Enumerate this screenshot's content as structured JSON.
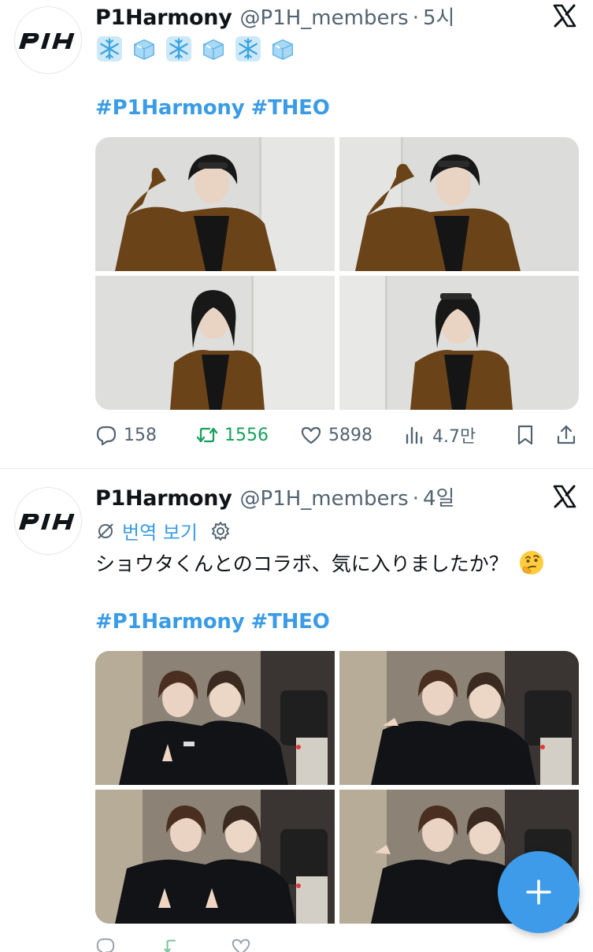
{
  "tweets": [
    {
      "display_name": "P1Harmony",
      "handle": "@P1H_members",
      "separator": "·",
      "time": "5시",
      "emojis": [
        "snowflake-icon",
        "ice-cube-icon",
        "snowflake-icon",
        "ice-cube-icon",
        "snowflake-icon",
        "ice-cube-icon"
      ],
      "hashtags": [
        "#P1Harmony",
        "#THEO"
      ],
      "photos": 4,
      "stats": {
        "replies": "158",
        "retweets": "1556",
        "likes": "5898",
        "views": "4.7만"
      }
    },
    {
      "display_name": "P1Harmony",
      "handle": "@P1H_members",
      "separator": "·",
      "time": "4일",
      "translate_label": "번역 보기",
      "text": "ショウタくんとのコラボ、気に入りましたか？",
      "text_emoji": "thinking-face-icon",
      "hashtags": [
        "#P1Harmony",
        "#THEO"
      ],
      "photos": 4
    }
  ],
  "colors": {
    "link": "#3a9be6",
    "retweet": "#17a05d",
    "muted": "#536471",
    "fab": "#3d9be9"
  },
  "fab": {
    "icon": "plus-icon"
  }
}
